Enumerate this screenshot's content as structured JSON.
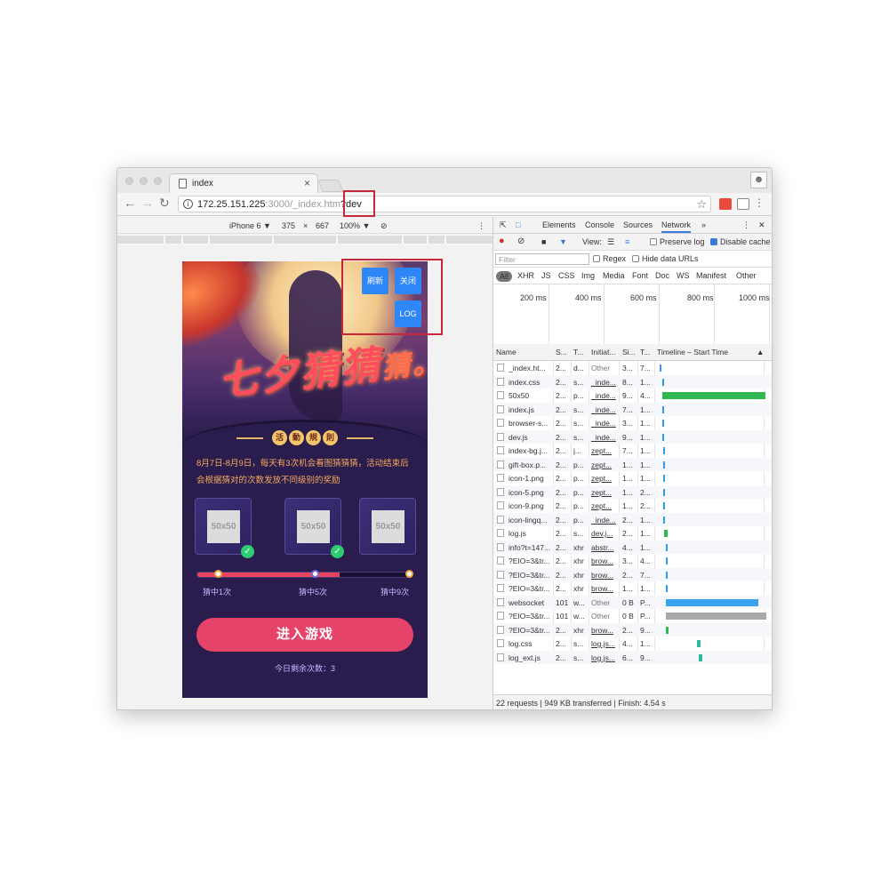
{
  "browser": {
    "tab_title": "index",
    "tab_close": "×",
    "url_host": "172.25.151.225",
    "url_path": ":3000/_index.htm",
    "url_query": "?dev",
    "profile_icon": "person-icon"
  },
  "device_toolbar": {
    "device": "iPhone 6 ▼",
    "width": "375",
    "times": "×",
    "height": "667",
    "zoom": "100% ▼",
    "rotate_icon": "⊘"
  },
  "page": {
    "hero_title_main": "七夕猜猜",
    "hero_title_tail": "猜。",
    "rules_badges": [
      "活",
      "動",
      "規",
      "則"
    ],
    "rules_text": "8月7日-8月9日，每天有3次机会看图猜猜猜，活动结束后会根据猜对的次数发放不同级别的奖励",
    "prizes": [
      {
        "label": "50x50",
        "checked": true
      },
      {
        "label": "50x50",
        "checked": true
      },
      {
        "label": "50x50",
        "checked": false
      }
    ],
    "check_mark": "✓",
    "progress": 0.66,
    "progress_labels": [
      "猜中1次",
      "猜中5次",
      "猜中9次"
    ],
    "enter_button": "进入游戏",
    "remaining": "今日剩余次数：3",
    "dev_buttons": {
      "refresh": "刷新",
      "close": "关闭",
      "log": "LOG"
    }
  },
  "devtools": {
    "tabs": [
      "Elements",
      "Console",
      "Sources",
      "Network",
      "»"
    ],
    "active_tab": "Network",
    "toolbar": {
      "view_label": "View:",
      "preserve_log": "Preserve log",
      "disable_cache": "Disable cache",
      "disable_cache_checked": true
    },
    "filter": {
      "placeholder": "Filter",
      "regex": "Regex",
      "hide_data_urls": "Hide data URLs",
      "types": [
        "All",
        "XHR",
        "JS",
        "CSS",
        "Img",
        "Media",
        "Font",
        "Doc",
        "WS",
        "Manifest",
        "Other"
      ]
    },
    "timeline_ticks": [
      "200 ms",
      "400 ms",
      "600 ms",
      "800 ms",
      "1000 ms"
    ],
    "columns": [
      "Name",
      "S...",
      "T...",
      "Initiat...",
      "Si...",
      "T...",
      "Timeline – Start Time",
      "▲"
    ],
    "rows": [
      {
        "name": "_index.ht...",
        "s": "2...",
        "t": "d...",
        "init": "Other",
        "size": "3...",
        "time": "7...",
        "init_link": false,
        "bar_start": 0.02,
        "bar_len": 0.01,
        "color": "#4a90e2"
      },
      {
        "name": "index.css",
        "s": "2...",
        "t": "s...",
        "init": "_inde...",
        "size": "8...",
        "time": "1...",
        "init_link": true,
        "bar_start": 0.04,
        "bar_len": 0.01,
        "color": "#2f9ee8"
      },
      {
        "name": "50x50",
        "s": "2...",
        "t": "p...",
        "init": "_inde...",
        "size": "9...",
        "time": "4...",
        "init_link": true,
        "bar_start": 0.04,
        "bar_len": 0.95,
        "color": "#2fb84f"
      },
      {
        "name": "index.js",
        "s": "2...",
        "t": "s...",
        "init": "_inde...",
        "size": "7...",
        "time": "1...",
        "init_link": true,
        "bar_start": 0.04,
        "bar_len": 0.01,
        "color": "#2f9ee8"
      },
      {
        "name": "browser-s...",
        "s": "2...",
        "t": "s...",
        "init": "_inde...",
        "size": "3...",
        "time": "1...",
        "init_link": true,
        "bar_start": 0.04,
        "bar_len": 0.01,
        "color": "#2f9ee8"
      },
      {
        "name": "dev.js",
        "s": "2...",
        "t": "s...",
        "init": "_inde...",
        "size": "9...",
        "time": "1...",
        "init_link": true,
        "bar_start": 0.04,
        "bar_len": 0.01,
        "color": "#2f9ee8"
      },
      {
        "name": "index-bg.j...",
        "s": "2...",
        "t": "j...",
        "init": "zept...",
        "size": "7...",
        "time": "1...",
        "init_link": true,
        "bar_start": 0.05,
        "bar_len": 0.015,
        "color": "#2f9ee8"
      },
      {
        "name": "gift-box.p...",
        "s": "2...",
        "t": "p...",
        "init": "zept...",
        "size": "1...",
        "time": "1...",
        "init_link": true,
        "bar_start": 0.05,
        "bar_len": 0.015,
        "color": "#2f9ee8"
      },
      {
        "name": "icon-1.png",
        "s": "2...",
        "t": "p...",
        "init": "zept...",
        "size": "1...",
        "time": "1...",
        "init_link": true,
        "bar_start": 0.05,
        "bar_len": 0.015,
        "color": "#2f9ee8"
      },
      {
        "name": "icon-5.png",
        "s": "2...",
        "t": "p...",
        "init": "zept...",
        "size": "1...",
        "time": "2...",
        "init_link": true,
        "bar_start": 0.05,
        "bar_len": 0.015,
        "color": "#2f9ee8"
      },
      {
        "name": "icon-9.png",
        "s": "2...",
        "t": "p...",
        "init": "zept...",
        "size": "1...",
        "time": "2...",
        "init_link": true,
        "bar_start": 0.05,
        "bar_len": 0.015,
        "color": "#2f9ee8"
      },
      {
        "name": "icon-lingq...",
        "s": "2...",
        "t": "p...",
        "init": "_inde...",
        "size": "2...",
        "time": "1...",
        "init_link": true,
        "bar_start": 0.05,
        "bar_len": 0.015,
        "color": "#2f9ee8"
      },
      {
        "name": "log.js",
        "s": "2...",
        "t": "s...",
        "init": "dev.j...",
        "size": "2...",
        "time": "1...",
        "init_link": true,
        "bar_start": 0.06,
        "bar_len": 0.03,
        "color": "#2fb84f"
      },
      {
        "name": "info?t=147...",
        "s": "2...",
        "t": "xhr",
        "init": "abstr...",
        "size": "4...",
        "time": "1...",
        "init_link": true,
        "bar_start": 0.07,
        "bar_len": 0.01,
        "color": "#2f9ee8"
      },
      {
        "name": "?EIO=3&tr...",
        "s": "2...",
        "t": "xhr",
        "init": "brow...",
        "size": "3...",
        "time": "4...",
        "init_link": true,
        "bar_start": 0.07,
        "bar_len": 0.01,
        "color": "#2f9ee8"
      },
      {
        "name": "?EIO=3&tr...",
        "s": "2...",
        "t": "xhr",
        "init": "brow...",
        "size": "2...",
        "time": "7...",
        "init_link": true,
        "bar_start": 0.07,
        "bar_len": 0.02,
        "color": "#2f9ee8"
      },
      {
        "name": "?EIO=3&tr...",
        "s": "2...",
        "t": "xhr",
        "init": "brow...",
        "size": "1...",
        "time": "1...",
        "init_link": true,
        "bar_start": 0.07,
        "bar_len": 0.015,
        "color": "#2f9ee8"
      },
      {
        "name": "websocket",
        "s": "101",
        "t": "w...",
        "init": "Other",
        "size": "0 B",
        "time": "P...",
        "init_link": false,
        "bar_start": 0.07,
        "bar_len": 0.86,
        "color": "#3aa3f0"
      },
      {
        "name": "?EIO=3&tr...",
        "s": "101",
        "t": "w...",
        "init": "Other",
        "size": "0 B",
        "time": "P...",
        "init_link": false,
        "bar_start": 0.07,
        "bar_len": 0.93,
        "color": "#a8a8a8"
      },
      {
        "name": "?EIO=3&tr...",
        "s": "2...",
        "t": "xhr",
        "init": "brow...",
        "size": "2...",
        "time": "9...",
        "init_link": true,
        "bar_start": 0.07,
        "bar_len": 0.03,
        "color": "#2fb84f"
      },
      {
        "name": "log.css",
        "s": "2...",
        "t": "s...",
        "init": "log.js...",
        "size": "4...",
        "time": "1...",
        "init_link": true,
        "bar_start": 0.36,
        "bar_len": 0.03,
        "color": "#2fb8a0"
      },
      {
        "name": "log_ext.js",
        "s": "2...",
        "t": "s...",
        "init": "log.js...",
        "size": "6...",
        "time": "9...",
        "init_link": true,
        "bar_start": 0.38,
        "bar_len": 0.03,
        "color": "#2fb8a0"
      }
    ],
    "status": "22 requests  |  949 KB transferred  |  Finish: 4.54 s"
  }
}
